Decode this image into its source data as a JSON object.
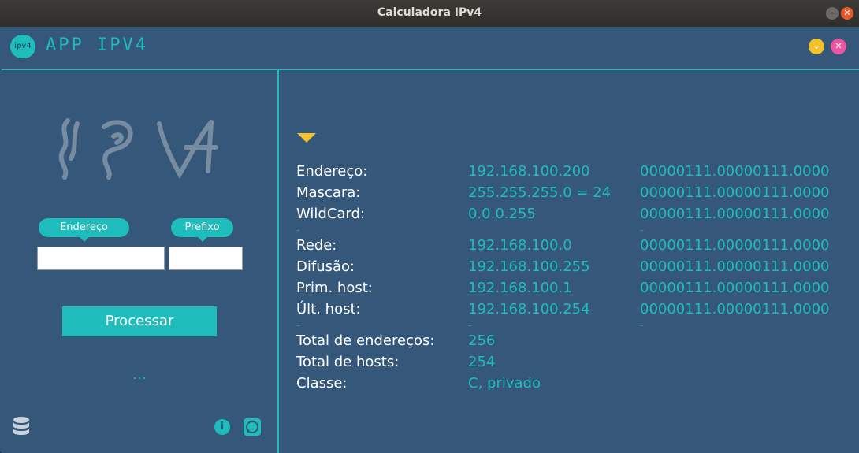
{
  "window": {
    "title": "Calculadora IPv4"
  },
  "header": {
    "logo_text": "ipv4",
    "app_title": "APP IPV4"
  },
  "sidebar": {
    "endereco_label": "Endereço",
    "prefixo_label": "Prefixo",
    "endereco_value": "",
    "prefixo_value": "",
    "process_label": "Processar",
    "status_text": "..."
  },
  "results": {
    "rows_a": [
      {
        "label": "Endereço:",
        "value": "192.168.100.200",
        "binary": "00000111.00000111.0000"
      },
      {
        "label": "Mascara:",
        "value": "255.255.255.0 = 24",
        "binary": "00000111.00000111.0000"
      },
      {
        "label": "WildCard:",
        "value": "0.0.0.255",
        "binary": "00000111.00000111.0000"
      }
    ],
    "rows_b": [
      {
        "label": "Rede:",
        "value": "192.168.100.0",
        "binary": "00000111.00000111.0000"
      },
      {
        "label": "Difusão:",
        "value": "192.168.100.255",
        "binary": "00000111.00000111.0000"
      },
      {
        "label": "Prim. host:",
        "value": "192.168.100.1",
        "binary": "00000111.00000111.0000"
      },
      {
        "label": "Últ. host:",
        "value": "192.168.100.254",
        "binary": "00000111.00000111.0000"
      }
    ],
    "rows_c": [
      {
        "label": "Total de endereços:",
        "value": "256"
      },
      {
        "label": "Total de hosts:",
        "value": "254"
      },
      {
        "label": "Classe:",
        "value": "C, privado"
      }
    ]
  },
  "colors": {
    "background": "#34577a",
    "accent": "#1fbcbc",
    "yellow": "#f3c12b",
    "pink": "#ea57a0"
  }
}
